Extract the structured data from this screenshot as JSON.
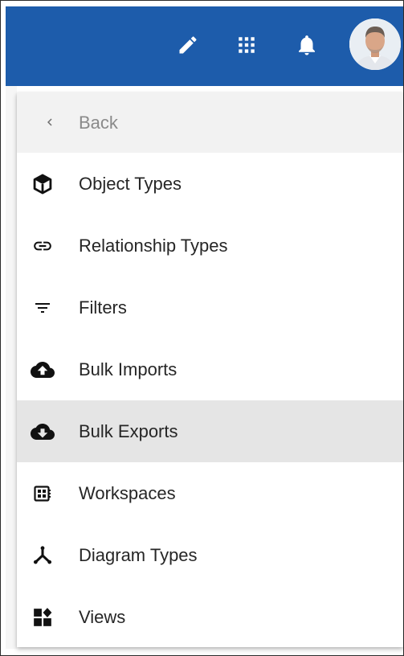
{
  "header": {
    "actions": [
      {
        "icon": "pencil-icon"
      },
      {
        "icon": "apps-grid-icon"
      },
      {
        "icon": "bell-icon"
      }
    ],
    "avatar_icon": "user-avatar",
    "bar_color": "#1d5cab"
  },
  "menu": {
    "back_label": "Back",
    "items": [
      {
        "label": "Object Types",
        "icon": "cube-icon"
      },
      {
        "label": "Relationship Types",
        "icon": "link-icon"
      },
      {
        "label": "Filters",
        "icon": "filter-icon"
      },
      {
        "label": "Bulk Imports",
        "icon": "cloud-upload-icon"
      },
      {
        "label": "Bulk Exports",
        "icon": "cloud-download-icon",
        "selected": true
      },
      {
        "label": "Workspaces",
        "icon": "workspaces-icon"
      },
      {
        "label": "Diagram Types",
        "icon": "diagram-icon"
      },
      {
        "label": "Views",
        "icon": "views-icon"
      }
    ]
  }
}
